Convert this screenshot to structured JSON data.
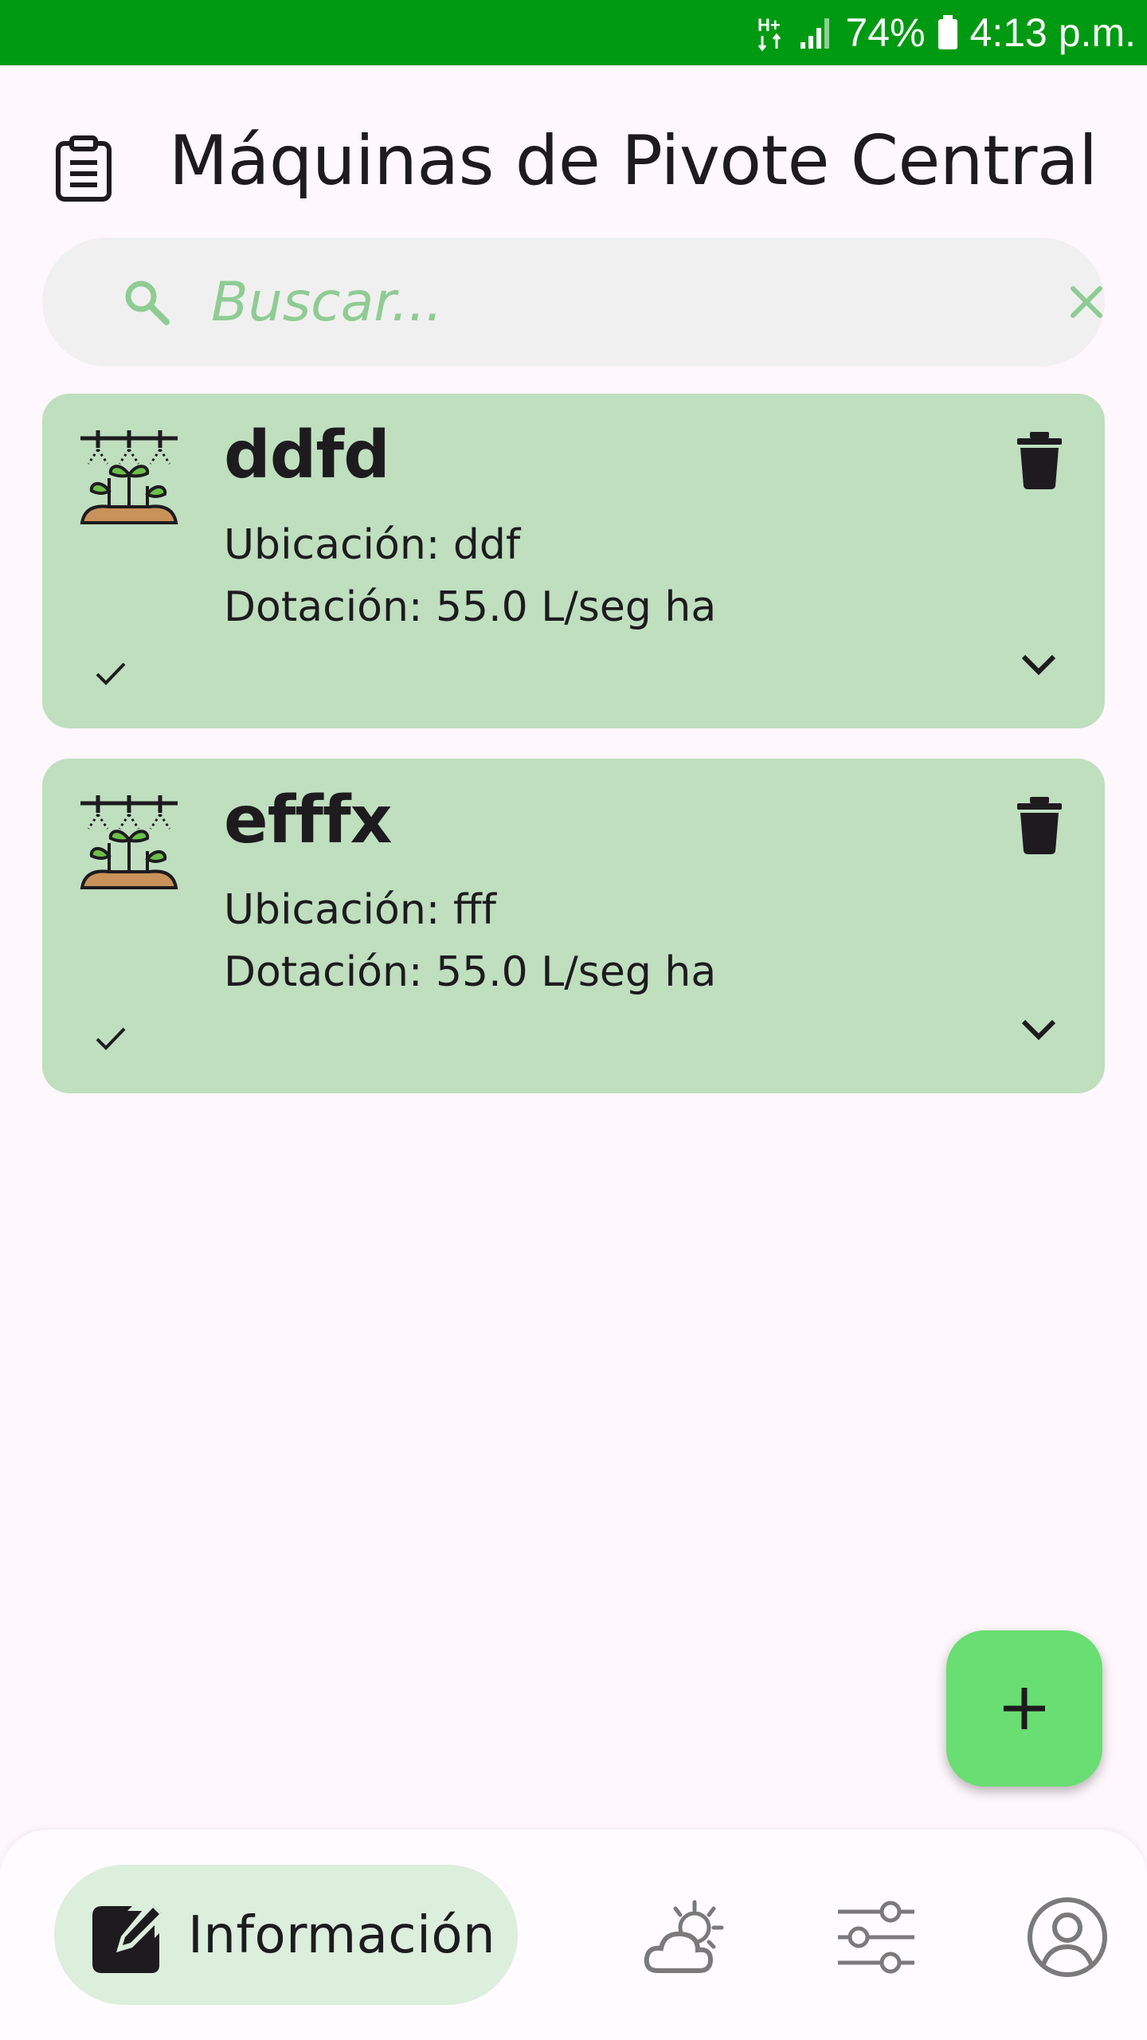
{
  "status_bar": {
    "network": "H+",
    "battery_percent": "74%",
    "time": "4:13 p.m.",
    "background_color": "#009A12"
  },
  "app_bar": {
    "title": "Máquinas de Pivote Central",
    "leading_icon": "clipboard-icon"
  },
  "search": {
    "placeholder": "Buscar...",
    "value": "",
    "leading_icon": "search-icon",
    "trailing_icon": "close-icon"
  },
  "machines": [
    {
      "name": "ddfd",
      "location_line": "Ubicación: ddf",
      "supply_line": "Dotación: 55.0 L/seg ha",
      "icon": "irrigated-plants-icon"
    },
    {
      "name": "efffx",
      "location_line": "Ubicación: fff",
      "supply_line": "Dotación: 55.0 L/seg ha",
      "icon": "irrigated-plants-icon"
    }
  ],
  "fab": {
    "icon": "plus-icon",
    "color": "#69DE72"
  },
  "bottom_nav": {
    "selected": "info",
    "items": [
      {
        "id": "info",
        "label": "Información",
        "icon": "edit-note-icon"
      },
      {
        "id": "weather",
        "icon": "partly-cloudy-icon"
      },
      {
        "id": "settings",
        "icon": "sliders-icon"
      },
      {
        "id": "profile",
        "icon": "account-circle-icon"
      }
    ]
  },
  "colors": {
    "card_background": "#BFDFBF",
    "search_placeholder": "#8FCC94",
    "nav_selected_pill": "#DCEEDC"
  }
}
